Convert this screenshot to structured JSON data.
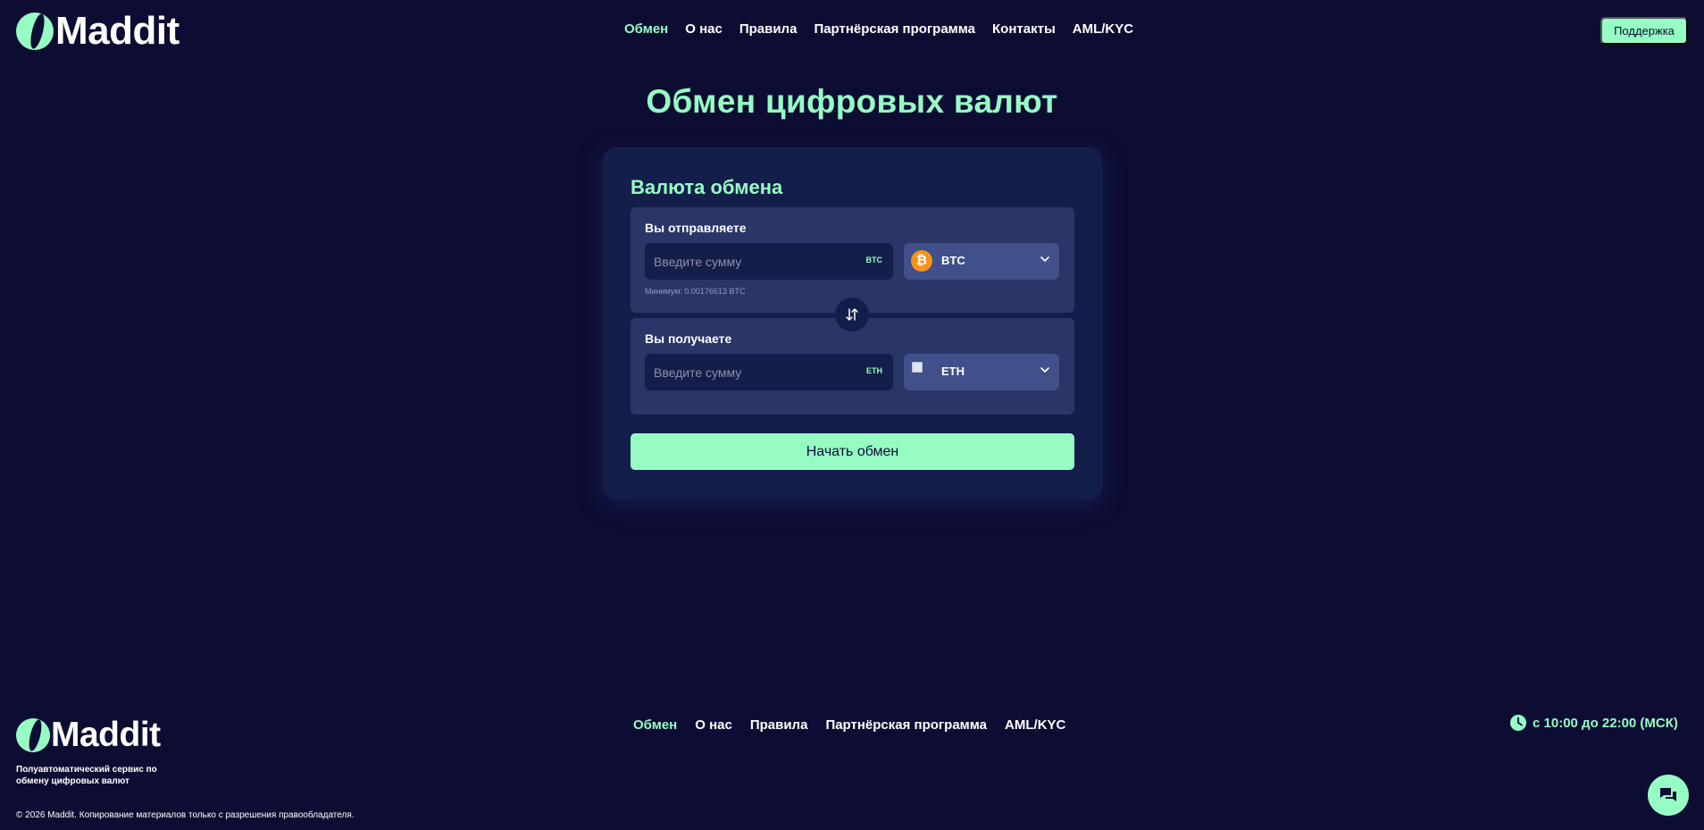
{
  "brand": {
    "name": "Maddit",
    "accent_color": "#96fcc4",
    "background_color": "#0d0d33"
  },
  "header": {
    "nav": [
      "Обмен",
      "О нас",
      "Правила",
      "Партнёрская программа",
      "Контакты",
      "AML/KYC"
    ],
    "active_nav": "Обмен",
    "support_label": "Поддержка"
  },
  "main": {
    "title": "Обмен цифровых валют",
    "card_title": "Валюта обмена",
    "send": {
      "label": "Вы отправляете",
      "placeholder": "Введите сумму",
      "unit": "BTC",
      "currency": "BTC",
      "currency_icon": "bitcoin-icon",
      "minimum_text": "Минимум: 0.00176613 BTC"
    },
    "receive": {
      "label": "Вы получаете",
      "placeholder": "Введите сумму",
      "unit": "ETH",
      "currency": "ETH",
      "currency_icon": "broken-image-icon"
    },
    "swap_icon": "swap-arrows-icon",
    "start_label": "Начать обмен"
  },
  "footer": {
    "nav": [
      "Обмен",
      "О нас",
      "Правила",
      "Партнёрская программа",
      "AML/KYC"
    ],
    "tagline": "Полуавтоматический сервис по обмену цифровых валют",
    "schedule": "с 10:00 до 22:00 (МСК)",
    "copyright": "© 2026 Maddit. Копирование материалов только с разрешения правообладателя.",
    "chat_icon": "chat-icon"
  }
}
